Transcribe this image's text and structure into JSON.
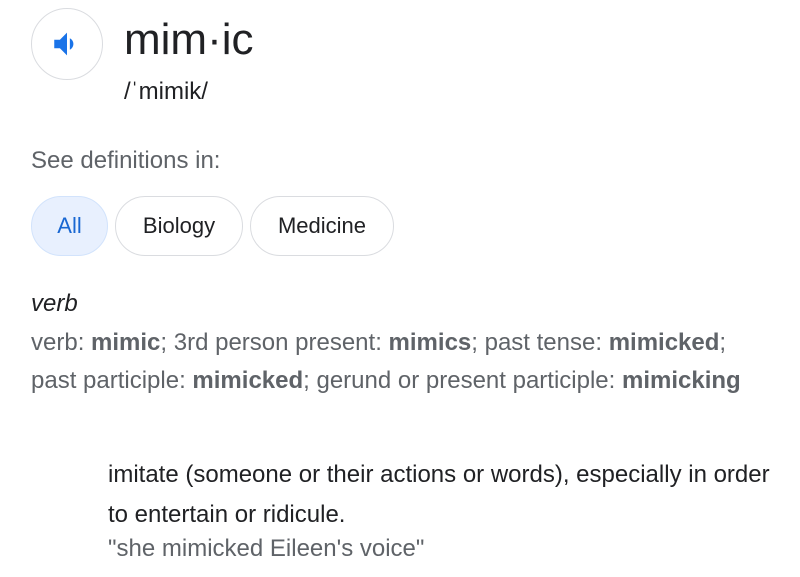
{
  "entry": {
    "speaker_icon": "speaker-volume-icon",
    "word": "mim·ic",
    "phonetic": "/ˈmimik/"
  },
  "see_definitions": {
    "label": "See definitions in:",
    "chips": [
      {
        "label": "All",
        "selected": true
      },
      {
        "label": "Biology",
        "selected": false
      },
      {
        "label": "Medicine",
        "selected": false
      }
    ]
  },
  "sense": {
    "part_of_speech": "verb",
    "forms": {
      "verb_label": "verb: ",
      "verb": "mimic",
      "third_person_label": "; 3rd person present: ",
      "third_person": "mimics",
      "past_tense_label": "; past tense: ",
      "past_tense": "mimicked",
      "past_participle_label": "; past participle: ",
      "past_participle": "mimicked",
      "gerund_label": "; gerund or present participle: ",
      "gerund": "mimicking"
    },
    "definition": "imitate (someone or their actions or words), especially in order to entertain or ridicule.",
    "example": "\"she mimicked Eileen's voice\""
  },
  "colors": {
    "accent": "#1a73e8",
    "chip_active_bg": "#e8f0fe",
    "secondary_text": "#5f6368"
  }
}
